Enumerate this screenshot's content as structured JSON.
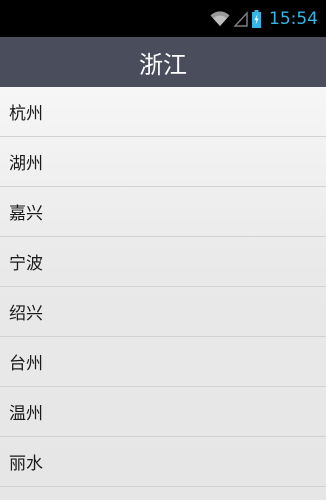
{
  "status_bar": {
    "time": "15:54",
    "icons": [
      "wifi-icon",
      "signal-icon",
      "battery-charging-icon"
    ],
    "accent_color": "#33b5e5"
  },
  "header": {
    "title": "浙江",
    "background_color": "#4a4e5c"
  },
  "cities": [
    {
      "label": "杭州"
    },
    {
      "label": "湖州"
    },
    {
      "label": "嘉兴"
    },
    {
      "label": "宁波"
    },
    {
      "label": "绍兴"
    },
    {
      "label": "台州"
    },
    {
      "label": "温州"
    },
    {
      "label": "丽水"
    }
  ]
}
